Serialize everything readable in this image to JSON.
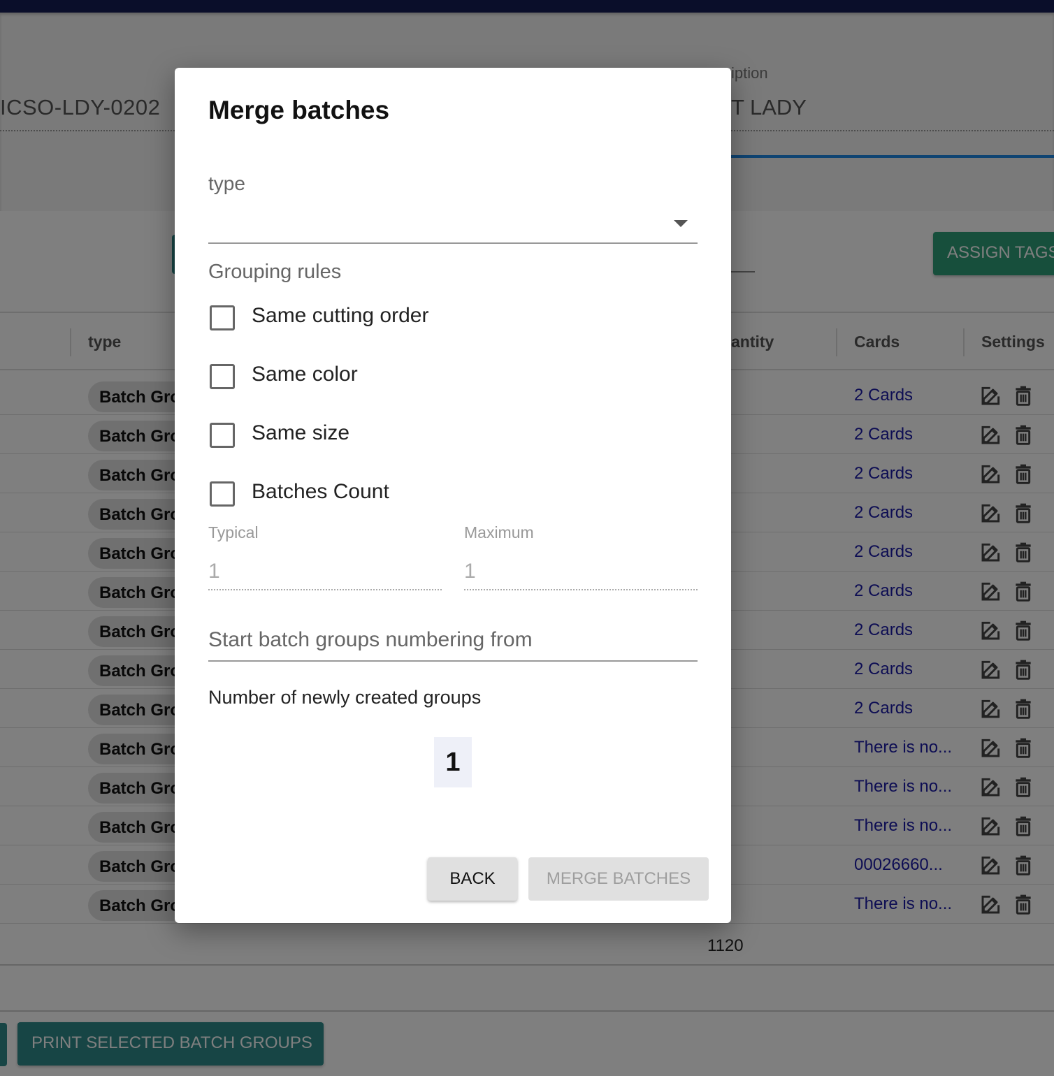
{
  "background": {
    "code_value": "ICSO-LDY-0202",
    "description_label": "iption",
    "description_value": "T LADY",
    "assign_tags_label": "ASSIGN TAGS",
    "columns": {
      "type": "type",
      "quantity": "antity",
      "cards": "Cards",
      "settings": "Settings"
    },
    "rows": [
      {
        "type": "Batch Gro",
        "cards": "2 Cards"
      },
      {
        "type": "Batch Gro",
        "cards": "2 Cards"
      },
      {
        "type": "Batch Gro",
        "cards": "2 Cards"
      },
      {
        "type": "Batch Gro",
        "cards": "2 Cards"
      },
      {
        "type": "Batch Gro",
        "cards": "2 Cards"
      },
      {
        "type": "Batch Gro",
        "cards": "2 Cards"
      },
      {
        "type": "Batch Gro",
        "cards": "2 Cards"
      },
      {
        "type": "Batch Gro",
        "cards": "2 Cards"
      },
      {
        "type": "Batch Gro",
        "cards": "2 Cards"
      },
      {
        "type": "Batch Gro",
        "cards": "There is no..."
      },
      {
        "type": "Batch Gro",
        "cards": "There is no..."
      },
      {
        "type": "Batch Gro",
        "cards": "There is no..."
      },
      {
        "type": "Batch Gro",
        "cards": "00026660..."
      },
      {
        "type": "Batch Gro",
        "cards": "There is no..."
      }
    ],
    "quantity_total": "1120",
    "print_button_label": "PRINT SELECTED BATCH GROUPS"
  },
  "dialog": {
    "title": "Merge batches",
    "type_label": "type",
    "type_value": "",
    "grouping_rules_label": "Grouping rules",
    "rules": [
      {
        "label": "Same cutting order",
        "checked": false
      },
      {
        "label": "Same color",
        "checked": false
      },
      {
        "label": "Same size",
        "checked": false
      },
      {
        "label": "Batches Count",
        "checked": false
      }
    ],
    "typical_label": "Typical",
    "typical_value": "1",
    "maximum_label": "Maximum",
    "maximum_value": "1",
    "start_numbering_placeholder": "Start batch groups numbering from",
    "new_groups_label": "Number of newly created groups",
    "new_groups_count": "1",
    "back_label": "BACK",
    "merge_label": "MERGE BATCHES"
  },
  "icons": {
    "edit": "edit-icon",
    "delete": "trash-icon",
    "dropdown": "caret-down-icon"
  },
  "colors": {
    "accent_teal": "#2e8b8b",
    "assign_green": "#2e9e78",
    "link_blue": "#1a1aa6",
    "tab_blue": "#1e88e5"
  }
}
